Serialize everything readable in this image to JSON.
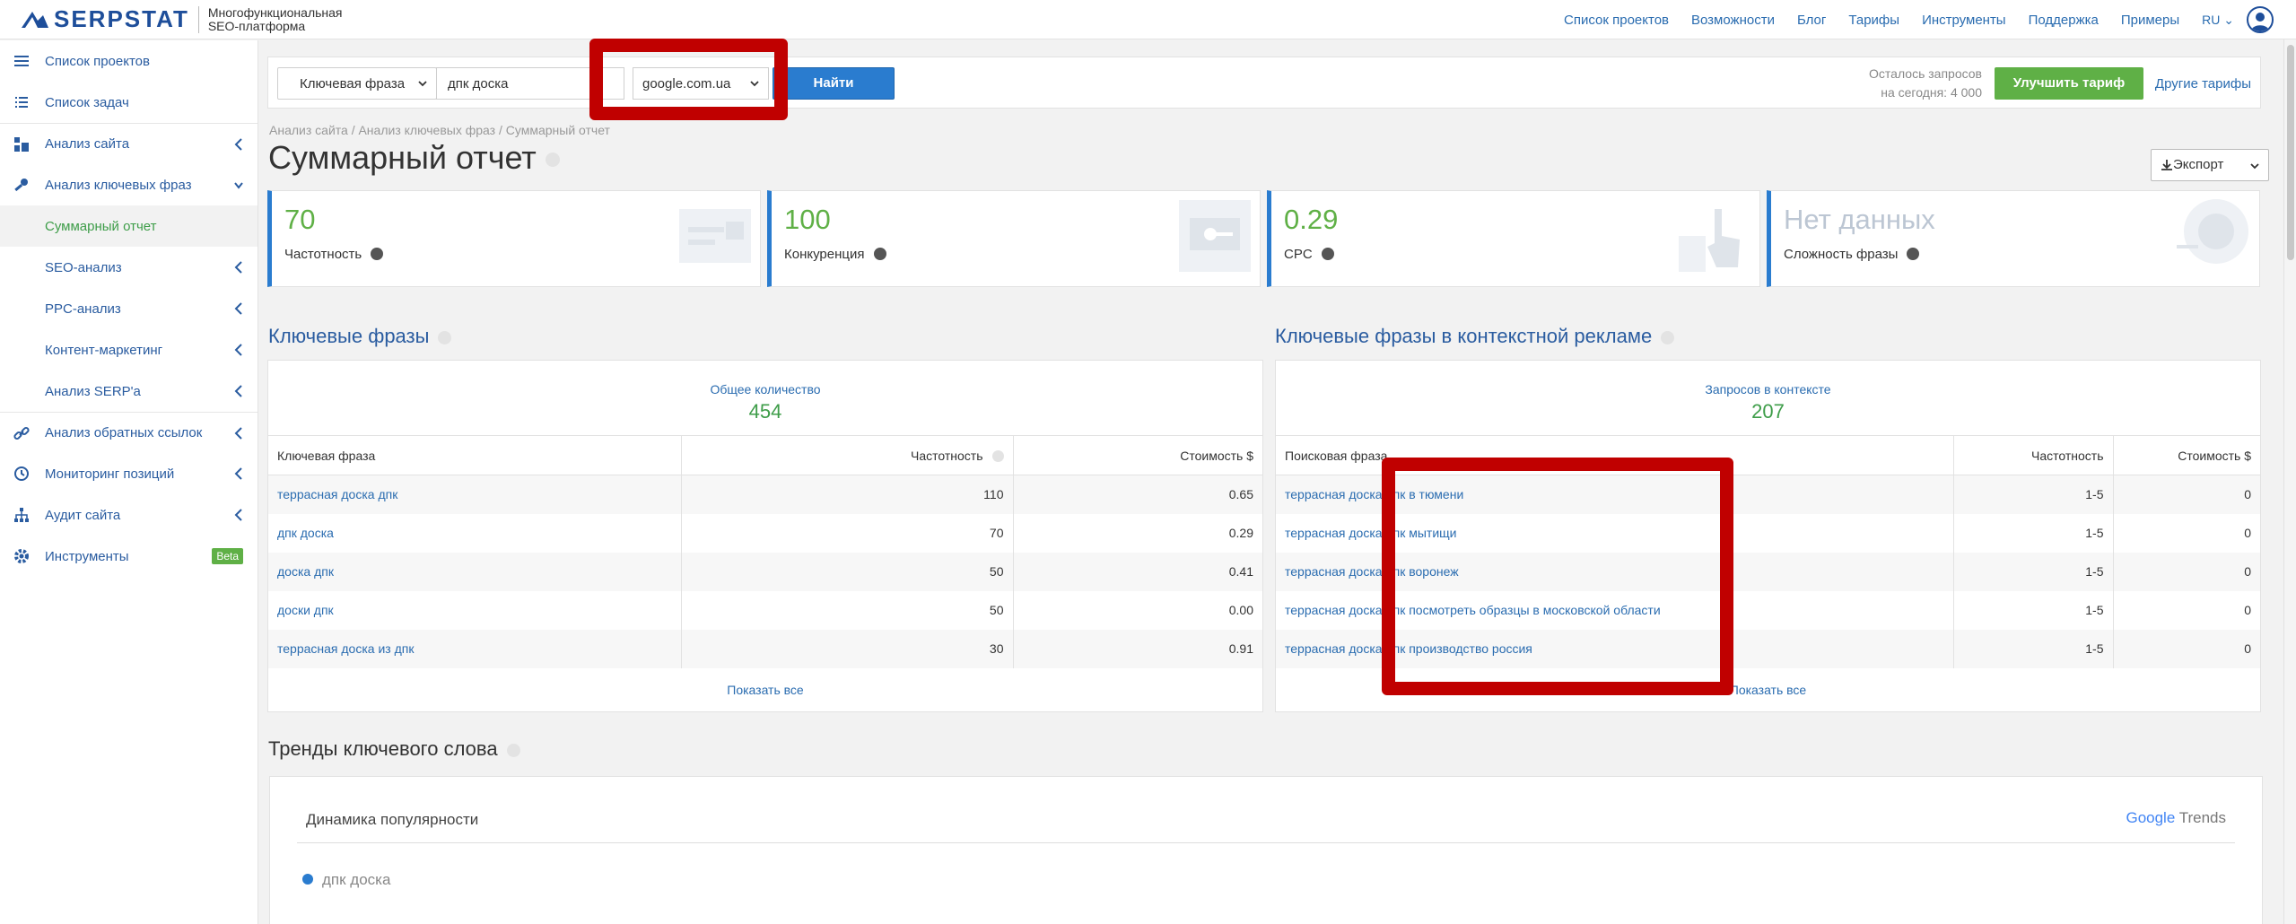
{
  "logo": {
    "text": "SERPSTAT",
    "subtitle_line1": "Многофункциональная",
    "subtitle_line2": "SEO-платформа"
  },
  "topnav": [
    "Список проектов",
    "Возможности",
    "Блог",
    "Тарифы",
    "Инструменты",
    "Поддержка",
    "Примеры"
  ],
  "lang": "RU",
  "sidebar": {
    "items": [
      {
        "label": "Список проектов"
      },
      {
        "label": "Список задач"
      },
      {
        "label": "Анализ сайта"
      },
      {
        "label": "Анализ ключевых фраз"
      },
      {
        "label": "Суммарный отчет"
      },
      {
        "label": "SEO-анализ"
      },
      {
        "label": "PPC-анализ"
      },
      {
        "label": "Контент-маркетинг"
      },
      {
        "label": "Анализ SERP'а"
      },
      {
        "label": "Анализ обратных ссылок"
      },
      {
        "label": "Мониторинг позиций"
      },
      {
        "label": "Аудит сайта"
      },
      {
        "label": "Инструменты"
      }
    ],
    "beta": "Beta"
  },
  "search": {
    "type": "Ключевая фраза",
    "query": "дпк доска",
    "domain": "google.com.ua",
    "button": "Найти"
  },
  "limits": {
    "line1": "Осталось запросов",
    "line2": "на сегодня: 4 000"
  },
  "upgrade": "Улучшить тариф",
  "other_tariffs": "Другие тарифы",
  "breadcrumb": "Анализ сайта / Анализ ключевых фраз / Суммарный отчет",
  "title": "Суммарный отчет",
  "export": "Экспорт",
  "cards": [
    {
      "value": "70",
      "label": "Частотность"
    },
    {
      "value": "100",
      "label": "Конкуренция"
    },
    {
      "value": "0.29",
      "label": "CPC"
    },
    {
      "value": "Нет данных",
      "label": "Сложность фразы"
    }
  ],
  "keywords": {
    "title": "Ключевые фразы",
    "total_label": "Общее количество",
    "total": "454",
    "headers": [
      "Ключевая фраза",
      "Частотность",
      "Стоимость $"
    ],
    "rows": [
      [
        "террасная доска дпк",
        "110",
        "0.65"
      ],
      [
        "дпк доска",
        "70",
        "0.29"
      ],
      [
        "доска дпк",
        "50",
        "0.41"
      ],
      [
        "доски дпк",
        "50",
        "0.00"
      ],
      [
        "террасная доска из дпк",
        "30",
        "0.91"
      ]
    ],
    "show_all": "Показать все"
  },
  "ppc": {
    "title": "Ключевые фразы в контекстной рекламе",
    "total_label": "Запросов в контексте",
    "total": "207",
    "headers": [
      "Поисковая фраза",
      "Частотность",
      "Стоимость $"
    ],
    "rows": [
      [
        "террасная доска дпк в тюмени",
        "1-5",
        "0"
      ],
      [
        "террасная доска дпк мытищи",
        "1-5",
        "0"
      ],
      [
        "террасная доска дпк воронеж",
        "1-5",
        "0"
      ],
      [
        "террасная доска дпк посмотреть образцы в московской области",
        "1-5",
        "0"
      ],
      [
        "террасная доска дпк производство россия",
        "1-5",
        "0"
      ]
    ],
    "show_all": "Показать все"
  },
  "trends": {
    "title": "Тренды ключевого слова",
    "subtitle": "Динамика популярности",
    "brand": "Google",
    "brand_suffix": "Trends",
    "legend": "дпк доска"
  },
  "colors": {
    "accent": "#2a7ccf",
    "green": "#5fb046",
    "highlight": "#c00000"
  }
}
